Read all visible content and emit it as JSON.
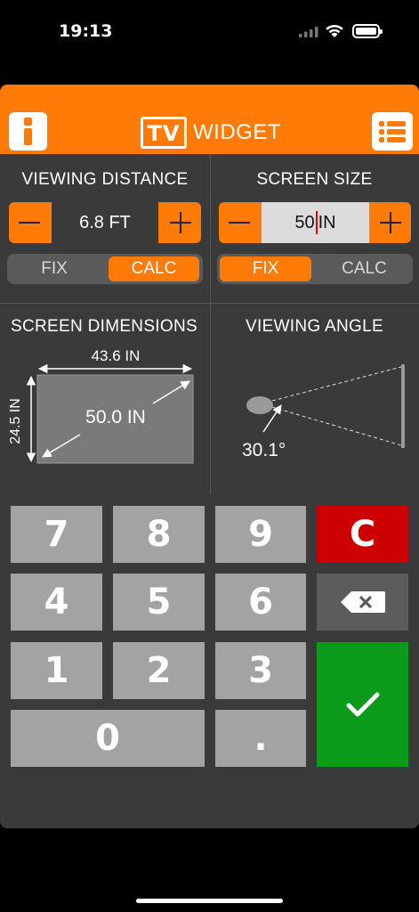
{
  "status": {
    "time": "19:13"
  },
  "header": {
    "logo_tv": "TV",
    "logo_word": "WIDGET"
  },
  "viewing_distance": {
    "title": "VIEWING DISTANCE",
    "value": "6.8 FT",
    "toggle": {
      "fix": "FIX",
      "calc": "CALC",
      "active": "CALC"
    }
  },
  "screen_size": {
    "title": "SCREEN SIZE",
    "value_before_cursor": "50",
    "value_after_cursor": "IN",
    "toggle": {
      "fix": "FIX",
      "calc": "CALC",
      "active": "FIX"
    }
  },
  "screen_dimensions": {
    "title": "SCREEN DIMENSIONS",
    "width": "43.6 IN",
    "height": "24.5 IN",
    "diagonal": "50.0 IN"
  },
  "viewing_angle": {
    "title": "VIEWING ANGLE",
    "angle": "30.1°"
  },
  "keypad": {
    "keys": [
      "7",
      "8",
      "9",
      "C",
      "4",
      "5",
      "6",
      "1",
      "2",
      "3",
      "0",
      "."
    ],
    "icons": {
      "backspace": "backspace-icon",
      "enter": "checkmark-icon"
    }
  },
  "colors": {
    "accent": "#ff7b08",
    "panel": "#3a3a3a",
    "clear": "#cc0000",
    "enter": "#0b9a1a",
    "key": "#a3a3a3"
  }
}
